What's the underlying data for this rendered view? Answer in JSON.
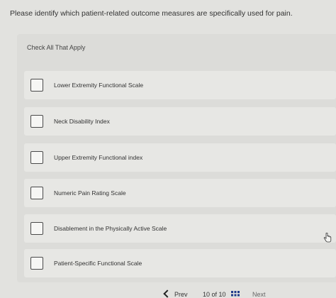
{
  "question": "Please identify which patient-related outcome measures are specifically used for pain.",
  "instruction": "Check All That Apply",
  "options": [
    {
      "label": "Lower Extremity Functional Scale"
    },
    {
      "label": "Neck Disability Index"
    },
    {
      "label": "Upper Extremity Functional index"
    },
    {
      "label": "Numeric Pain Rating Scale"
    },
    {
      "label": "Disablement in the Physically Active Scale"
    },
    {
      "label": "Patient-Specific Functional Scale"
    }
  ],
  "footer": {
    "prev_label": "Prev",
    "page_counter": "10 of 10",
    "next_label": "Next"
  }
}
